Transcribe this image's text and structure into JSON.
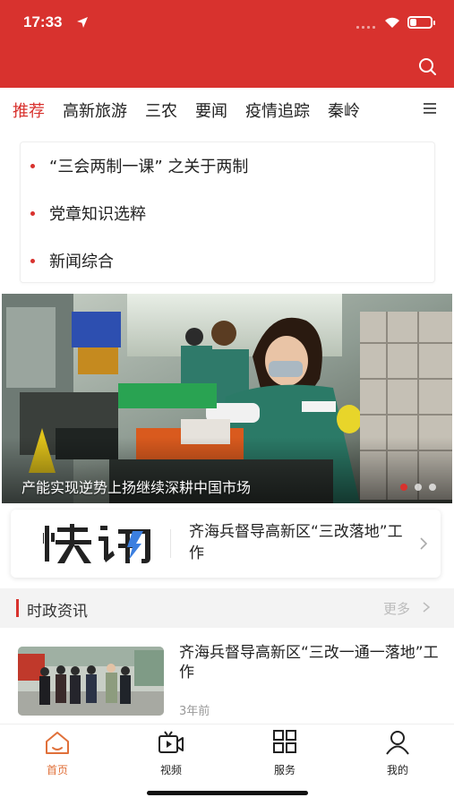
{
  "status_bar": {
    "time": "17:33",
    "battery_level": 0.3
  },
  "header": {
    "background_color": "#d8322e",
    "search_icon": "search-icon"
  },
  "tabs": [
    {
      "label": "推荐",
      "active": true
    },
    {
      "label": "高新旅游",
      "active": false
    },
    {
      "label": "三农",
      "active": false
    },
    {
      "label": "要闻",
      "active": false
    },
    {
      "label": "疫情追踪",
      "active": false
    },
    {
      "label": "秦岭",
      "active": false
    }
  ],
  "notices": [
    {
      "text": "“三会两制一课” 之关于两制"
    },
    {
      "text": "党章知识选粹"
    },
    {
      "text": "新闻综合"
    }
  ],
  "banner": {
    "caption": "产能实现逆势上扬继续深耕中国市场",
    "slide_count": 3,
    "active_slide": 1
  },
  "flash": {
    "logo_text": "快讯",
    "text": "齐海兵督导高新区“三改落地”工作"
  },
  "section": {
    "title": "时政资讯",
    "more_label": "更多"
  },
  "news": [
    {
      "title": "齐海兵督导高新区“三改一通一落地”工作",
      "time": "3年前"
    }
  ],
  "bottom_nav": [
    {
      "label": "首页",
      "icon": "home-icon",
      "active": true
    },
    {
      "label": "视频",
      "icon": "video-icon",
      "active": false
    },
    {
      "label": "服务",
      "icon": "grid-icon",
      "active": false
    },
    {
      "label": "我的",
      "icon": "user-icon",
      "active": false
    }
  ],
  "colors": {
    "brand": "#d8322e",
    "nav_active": "#e0703a"
  }
}
